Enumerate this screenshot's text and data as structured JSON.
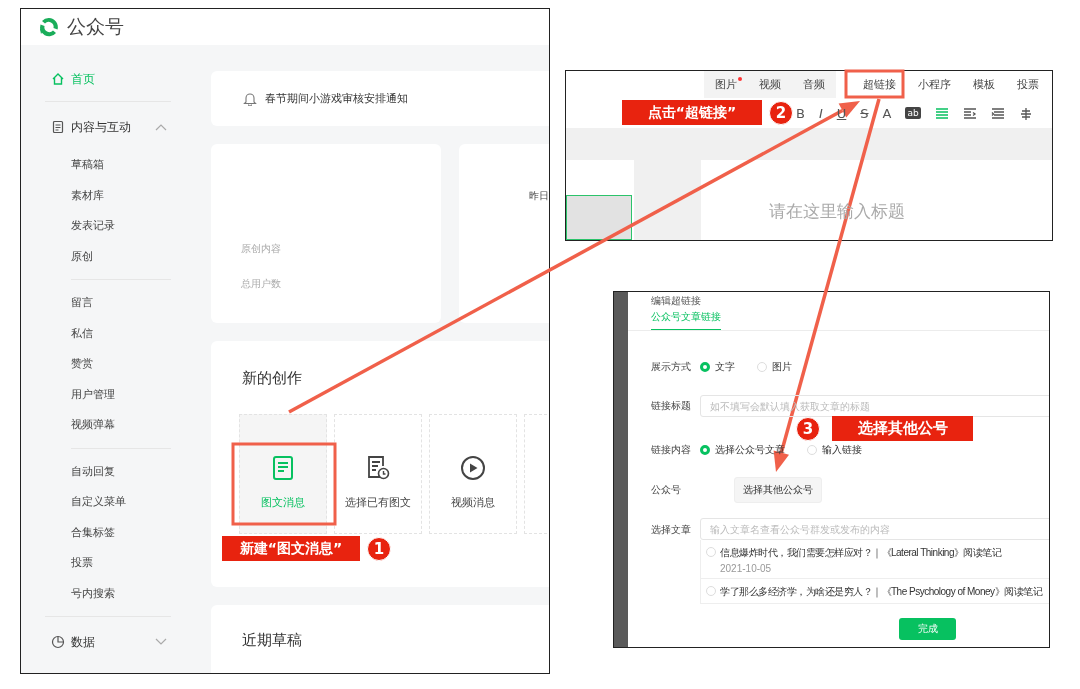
{
  "home_screen": {
    "brand": "公众号",
    "sidebar": [
      {
        "label": "首页",
        "selected": true
      },
      {
        "label": "内容与互动",
        "selected": false,
        "expanded": true,
        "sections": [
          [
            {
              "label": "草稿箱",
              "selected": false
            },
            {
              "label": "素材库",
              "selected": false
            },
            {
              "label": "发表记录",
              "selected": false
            },
            {
              "label": "原创",
              "selected": false
            }
          ],
          [
            {
              "label": "留言",
              "selected": false
            },
            {
              "label": "私信",
              "selected": false
            },
            {
              "label": "赞赏",
              "selected": false
            },
            {
              "label": "用户管理",
              "selected": false
            },
            {
              "label": "视频弹幕",
              "selected": false
            }
          ],
          [
            {
              "label": "自动回复",
              "selected": false
            },
            {
              "label": "自定义菜单",
              "selected": false
            },
            {
              "label": "合集标签",
              "selected": false
            },
            {
              "label": "投票",
              "selected": false
            },
            {
              "label": "号内搜索",
              "selected": false
            }
          ]
        ]
      },
      {
        "label": "数据",
        "selected": false,
        "expanded": false
      }
    ],
    "notice": "春节期间小游戏审核安排通知",
    "stats_card": {
      "labels": [
        "原创内容",
        "总用户数"
      ]
    },
    "stats_card_2": {
      "label": "昨日"
    },
    "create_card": {
      "title": "新的创作",
      "tiles": [
        {
          "label": "图文消息",
          "selected": true
        },
        {
          "label": "选择已有图文",
          "selected": false
        },
        {
          "label": "视频消息",
          "selected": false
        }
      ]
    },
    "drafts_card": {
      "title": "近期草稿"
    }
  },
  "editor_screen": {
    "insert_tabs": [
      {
        "label": "图片",
        "badge": true
      },
      {
        "label": "视频",
        "badge": false
      },
      {
        "label": "音频",
        "badge": false
      },
      {
        "label": "超链接",
        "badge": false
      },
      {
        "label": "小程序",
        "badge": false
      },
      {
        "label": "模板",
        "badge": false
      },
      {
        "label": "投票",
        "badge": false
      }
    ],
    "format_buttons": [
      {
        "label": "B",
        "kind": "bold"
      },
      {
        "label": "I",
        "kind": "italic"
      },
      {
        "label": "U",
        "kind": "underline"
      },
      {
        "label": "S",
        "kind": "strike"
      },
      {
        "label": "A",
        "kind": "color"
      },
      {
        "label": "ab",
        "kind": "highlight"
      }
    ],
    "align_buttons": [
      {
        "selected": true
      },
      {
        "selected": false
      },
      {
        "selected": false
      },
      {
        "selected": false
      }
    ],
    "title_placeholder": "请在这里输入标题"
  },
  "link_dialog": {
    "title": "编辑超链接",
    "tab": {
      "label": "公众号文章链接",
      "selected": true
    },
    "rows": [
      {
        "kind": "radio",
        "label": "展示方式",
        "options": [
          {
            "label": "文字",
            "selected": true
          },
          {
            "label": "图片",
            "selected": false
          }
        ]
      },
      {
        "kind": "input",
        "label": "链接标题",
        "placeholder": "如不填写会默认填入获取文章的标题"
      },
      {
        "kind": "radio",
        "label": "链接内容",
        "options": [
          {
            "label": "选择公众号文章",
            "selected": true
          },
          {
            "label": "输入链接",
            "selected": false
          }
        ]
      },
      {
        "kind": "button",
        "label": "公众号",
        "button": "选择其他公众号"
      },
      {
        "kind": "search",
        "label": "选择文章",
        "placeholder": "输入文章名查看公众号群发或发布的内容",
        "articles": [
          {
            "title": "信息爆炸时代，我们需要怎样应对？｜《Lateral Thinking》阅读笔记",
            "date": "2021-10-05",
            "selected": false
          },
          {
            "title": "学了那么多经济学，为啥还是穷人？｜《The Psychology of Money》阅读笔记",
            "selected": false
          }
        ]
      }
    ],
    "confirm": "完成"
  },
  "annotations": [
    {
      "number": "1",
      "text": "新建“图文消息”"
    },
    {
      "number": "2",
      "text": "点击“超链接”"
    },
    {
      "number": "3",
      "text": "选择其他公号"
    }
  ]
}
